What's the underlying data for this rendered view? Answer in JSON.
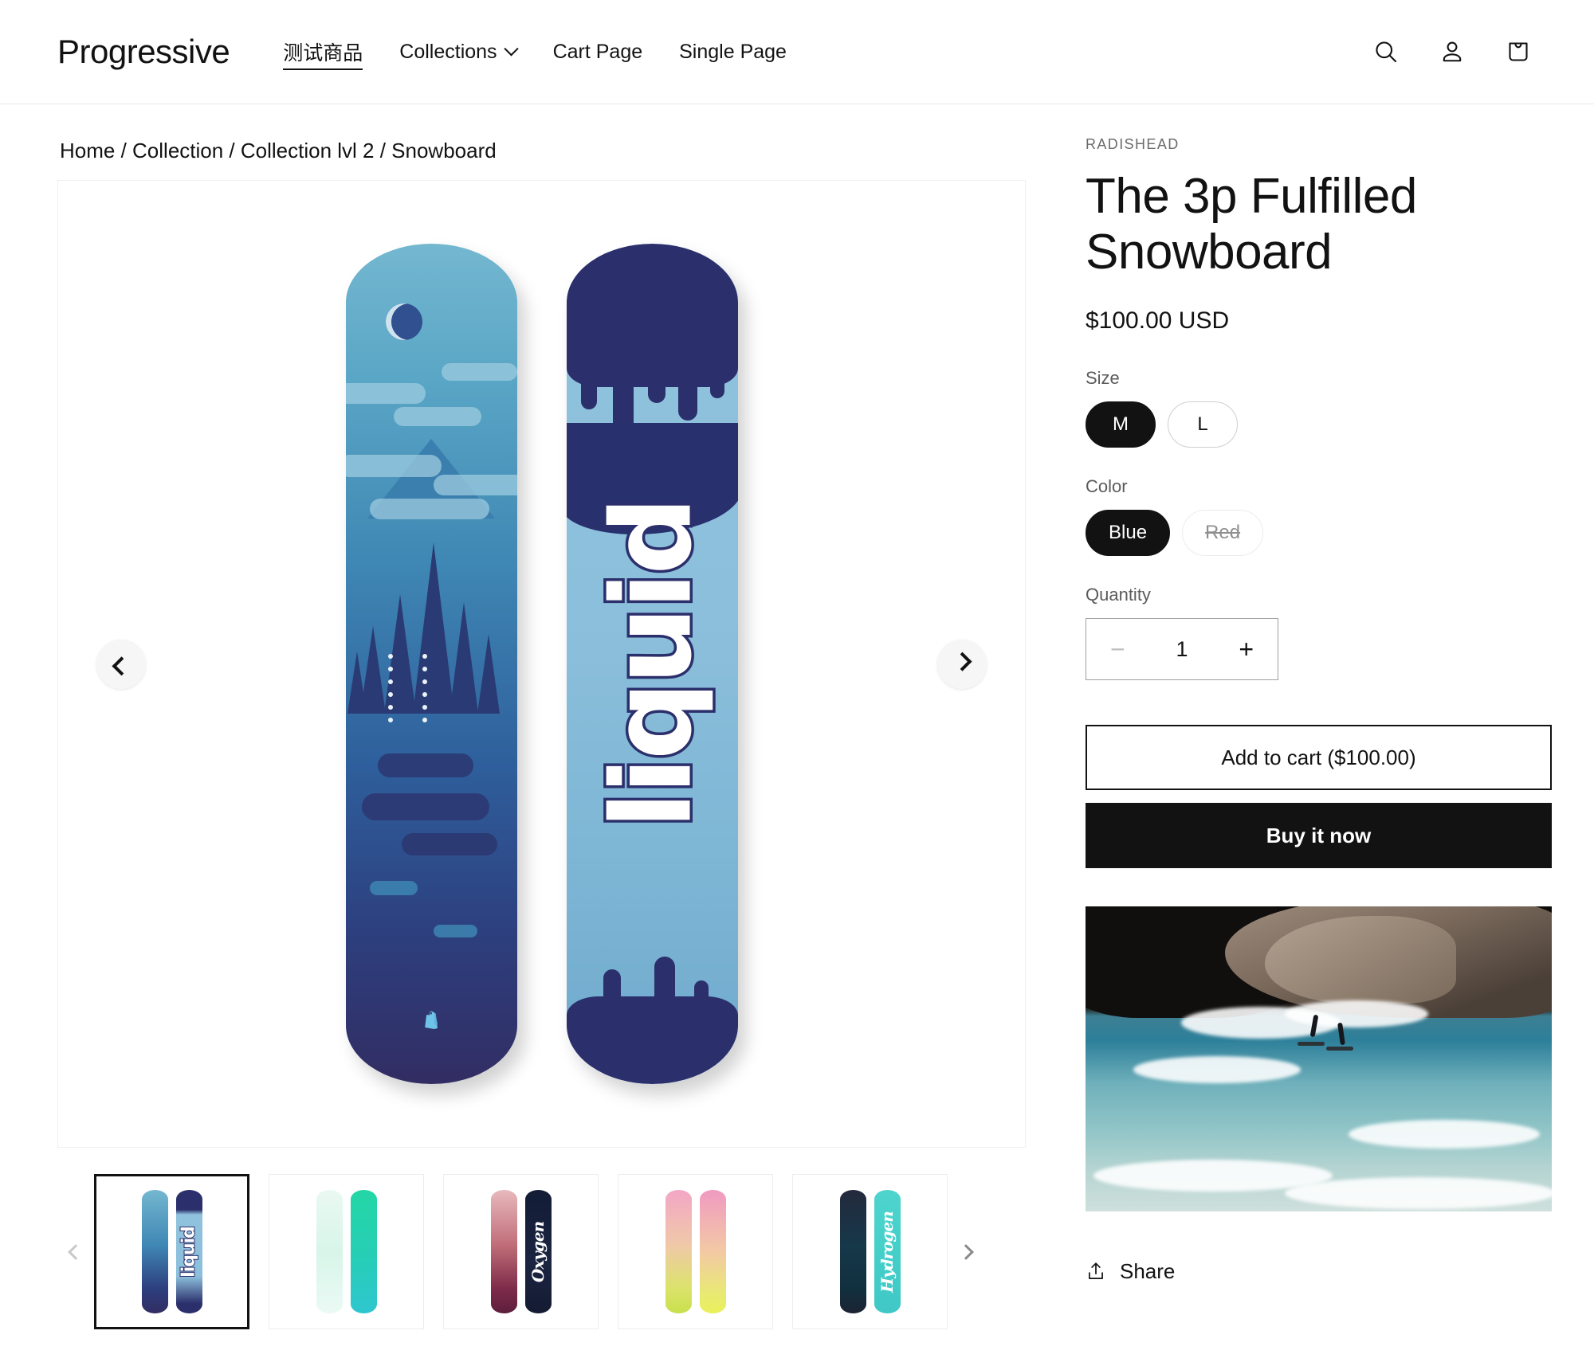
{
  "header": {
    "brand": "Progressive",
    "nav": [
      {
        "label": "测试商品",
        "active": true,
        "has_dropdown": false
      },
      {
        "label": "Collections",
        "active": false,
        "has_dropdown": true
      },
      {
        "label": "Cart Page",
        "active": false,
        "has_dropdown": false
      },
      {
        "label": "Single Page",
        "active": false,
        "has_dropdown": false
      }
    ],
    "actions": [
      {
        "name": "search-icon",
        "label": "Search"
      },
      {
        "name": "account-icon",
        "label": "Log in"
      },
      {
        "name": "cart-icon",
        "label": "Cart"
      }
    ]
  },
  "breadcrumb": {
    "items": [
      "Home",
      "Collection",
      "Collection lvl 2",
      "Snowboard"
    ],
    "separator": "/",
    "text": "Home / Collection / Collection lvl 2 / Snowboard"
  },
  "gallery": {
    "prev_label": "Previous slide",
    "next_label": "Next slide",
    "thumb_prev_label": "Slide left",
    "thumb_next_label": "Slide right",
    "main_image_alt": "The 3p Fulfilled Snowboard - Liquid blue design",
    "board_word": "liquid",
    "thumbnails": [
      {
        "name": "thumb-liquid",
        "alt": "Liquid snowboard",
        "selected": true
      },
      {
        "name": "thumb-teal",
        "alt": "Teal snowboard",
        "selected": false
      },
      {
        "name": "thumb-oxygen",
        "alt": "Oxygen snowboard",
        "selected": false
      },
      {
        "name": "thumb-sunset",
        "alt": "Pink yellow snowboard",
        "selected": false
      },
      {
        "name": "thumb-hydrogen",
        "alt": "Hydrogen snowboard",
        "selected": false
      }
    ],
    "thumb_words": [
      "liquid",
      "",
      "Oxygen",
      "",
      "Hydrogen"
    ]
  },
  "product": {
    "vendor": "RADISHEAD",
    "title": "The 3p Fulfilled Snowboard",
    "price": "$100.00 USD",
    "options": [
      {
        "name": "Size",
        "label": "Size",
        "values": [
          {
            "label": "M",
            "selected": true,
            "available": true
          },
          {
            "label": "L",
            "selected": false,
            "available": true
          }
        ]
      },
      {
        "name": "Color",
        "label": "Color",
        "values": [
          {
            "label": "Blue",
            "selected": true,
            "available": true
          },
          {
            "label": "Red",
            "selected": false,
            "available": false
          }
        ]
      }
    ],
    "quantity": {
      "label": "Quantity",
      "value": "1",
      "minus": "−",
      "plus": "+",
      "minus_disabled": true
    },
    "add_to_cart": "Add to cart ($100.00)",
    "buy_it_now": "Buy it now",
    "share": "Share",
    "media_alt": "Two surfers riding a wave next to rocky cliffs"
  },
  "colors": {
    "text": "#121212",
    "muted": "#5b5b5b",
    "border": "#cfcfcf",
    "accent_dark": "#121212",
    "page_bg": "#ffffff"
  }
}
